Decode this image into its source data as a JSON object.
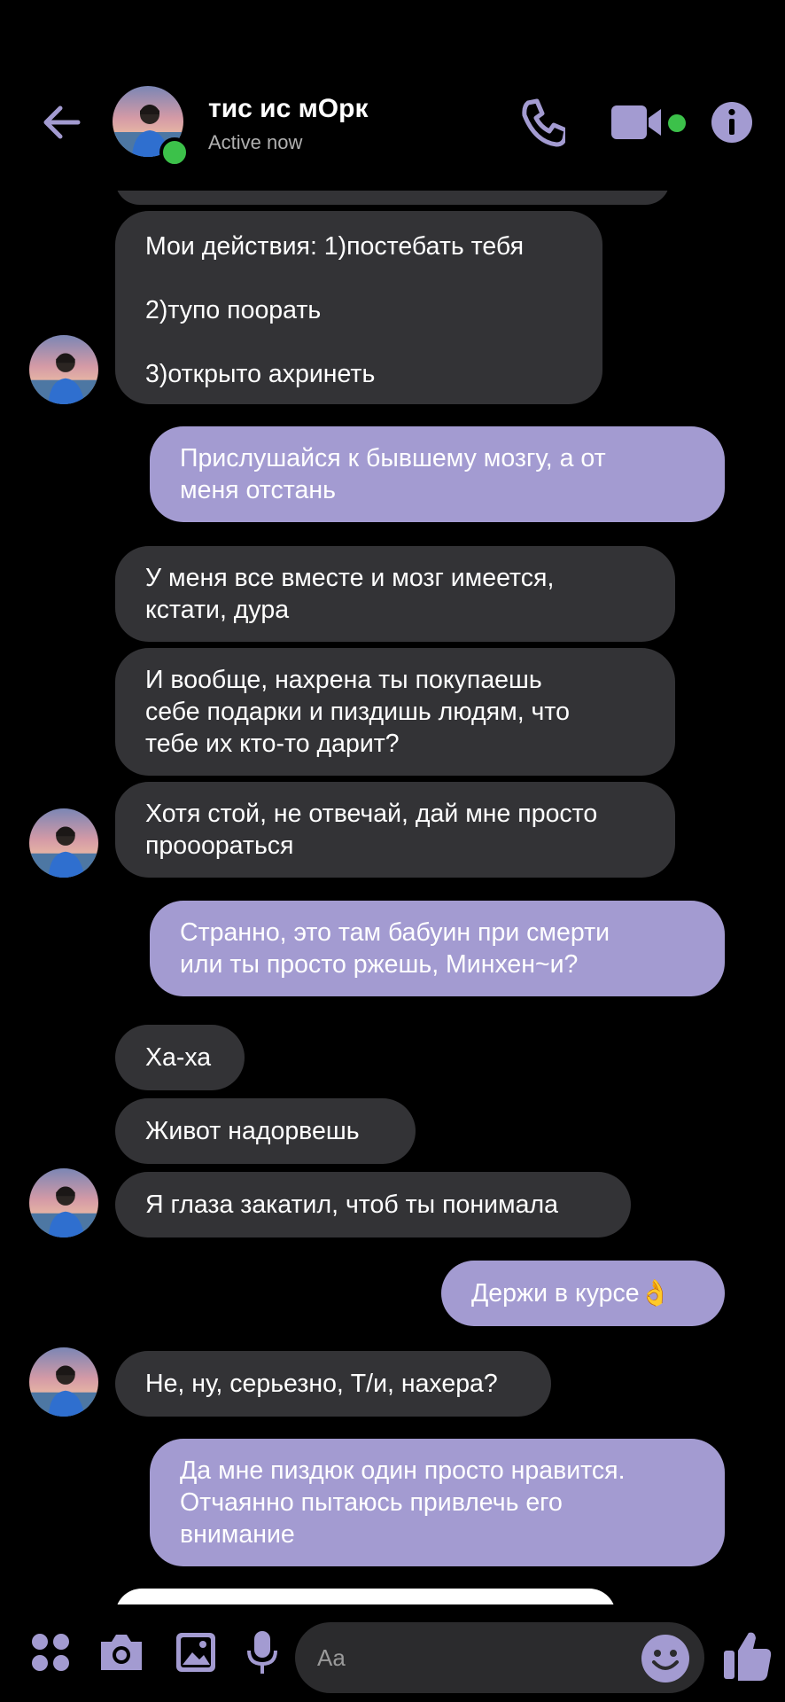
{
  "header": {
    "contact_name": "тис ис мОрк",
    "status": "Active now",
    "icons": [
      "back-arrow-icon",
      "phone-icon",
      "video-camera-icon",
      "info-icon"
    ],
    "accent_color": "#a39bd1",
    "online_color": "#3cc14a"
  },
  "messages": [
    {
      "side": "in",
      "lines": [
        "Мои действия: 1)постебать тебя",
        "",
        "2)тупо поорать",
        "",
        "3)открыто ахринеть"
      ]
    },
    {
      "side": "out",
      "lines": [
        "Прислушайся к бывшему мозгу, а от",
        "меня отстань"
      ]
    },
    {
      "side": "in",
      "lines": [
        "У меня все вместе и мозг имеется,",
        "кстати, дура"
      ]
    },
    {
      "side": "in",
      "lines": [
        "И вообще, нахрена ты покупаешь",
        "себе подарки и пиздишь людям, что",
        "тебе их кто-то дарит?"
      ]
    },
    {
      "side": "in",
      "lines": [
        "Хотя стой, не отвечай, дай мне просто",
        "прооораться"
      ]
    },
    {
      "side": "out",
      "lines": [
        "Странно, это там бабуин при смерти",
        "или ты просто ржешь, Минхен~и?"
      ]
    },
    {
      "side": "in",
      "lines": [
        "Ха-ха"
      ]
    },
    {
      "side": "in",
      "lines": [
        "Живот надорвешь"
      ]
    },
    {
      "side": "in",
      "lines": [
        "Я глаза закатил, чтоб ты понимала"
      ]
    },
    {
      "side": "out",
      "lines": [
        "Держи в курсе👌"
      ]
    },
    {
      "side": "in",
      "lines": [
        "Не, ну, серьезно, Т/и, нахера?"
      ]
    },
    {
      "side": "out",
      "lines": [
        "Да мне пиздюк один просто нравится.",
        "Отчаянно пытаюсь привлечь его",
        "внимание"
      ]
    }
  ],
  "composer": {
    "placeholder": "Aa",
    "icons": [
      "apps-icon",
      "camera-icon",
      "gallery-icon",
      "microphone-icon",
      "emoji-icon",
      "thumbs-up-icon"
    ]
  }
}
